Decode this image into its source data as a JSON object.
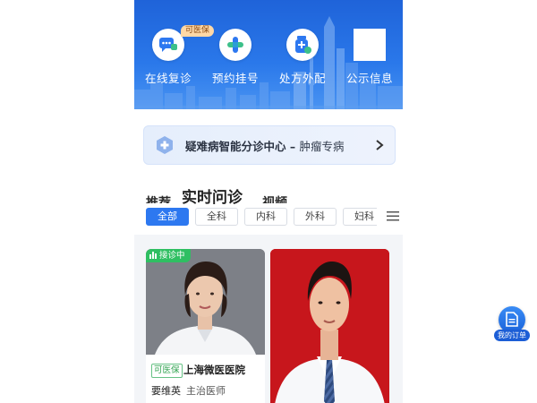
{
  "quick_actions": [
    {
      "label": "在线复诊",
      "icon": "chat-bubble-icon",
      "badge": "可医保"
    },
    {
      "label": "预约挂号",
      "icon": "cross-medical-icon"
    },
    {
      "label": "处方外配",
      "icon": "medicine-bottle-icon"
    },
    {
      "label": "公示信息",
      "icon": "blank-square-icon"
    }
  ],
  "banner": {
    "title": "疑难病智能分诊中心 – ",
    "subtitle": "肿瘤专病"
  },
  "section_tabs": {
    "left": "推荐",
    "active": "实时问诊",
    "right": "视频"
  },
  "filter_chips": [
    "全部",
    "全科",
    "内科",
    "外科",
    "妇科"
  ],
  "filter_active": "全部",
  "doctors": [
    {
      "status_badge": "接诊中",
      "insurance_tag": "可医保",
      "hospital": "上海微医医院",
      "name": "要维英",
      "title": "主治医师"
    },
    {}
  ],
  "floating_button": {
    "label": "我的订单",
    "icon": "document-icon"
  },
  "colors": {
    "primary": "#2d78f0",
    "header_blue": "#1f63d9",
    "live_green": "#2fbf62",
    "card_red": "#c9161b"
  }
}
